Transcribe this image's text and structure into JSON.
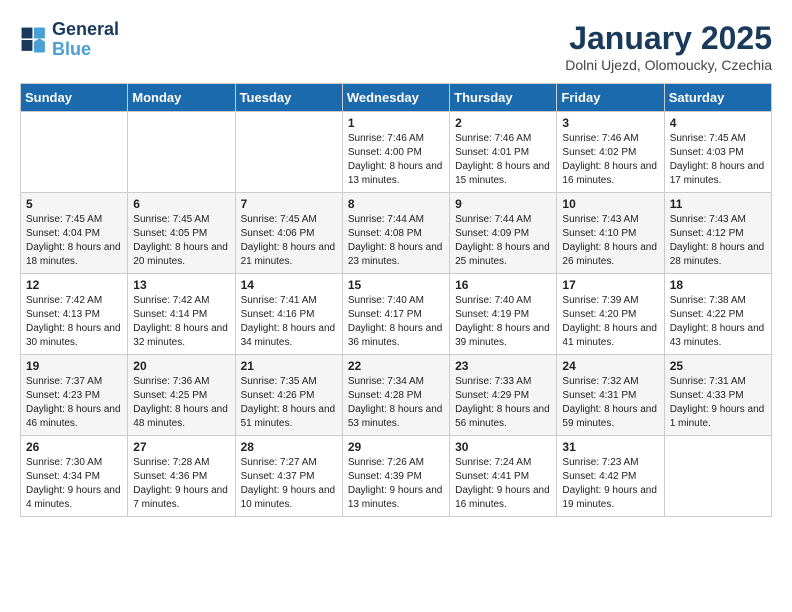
{
  "logo": {
    "line1": "General",
    "line2": "Blue"
  },
  "title": "January 2025",
  "subtitle": "Dolni Ujezd, Olomoucky, Czechia",
  "weekdays": [
    "Sunday",
    "Monday",
    "Tuesday",
    "Wednesday",
    "Thursday",
    "Friday",
    "Saturday"
  ],
  "weeks": [
    [
      {
        "day": "",
        "info": ""
      },
      {
        "day": "",
        "info": ""
      },
      {
        "day": "",
        "info": ""
      },
      {
        "day": "1",
        "info": "Sunrise: 7:46 AM\nSunset: 4:00 PM\nDaylight: 8 hours and 13 minutes."
      },
      {
        "day": "2",
        "info": "Sunrise: 7:46 AM\nSunset: 4:01 PM\nDaylight: 8 hours and 15 minutes."
      },
      {
        "day": "3",
        "info": "Sunrise: 7:46 AM\nSunset: 4:02 PM\nDaylight: 8 hours and 16 minutes."
      },
      {
        "day": "4",
        "info": "Sunrise: 7:45 AM\nSunset: 4:03 PM\nDaylight: 8 hours and 17 minutes."
      }
    ],
    [
      {
        "day": "5",
        "info": "Sunrise: 7:45 AM\nSunset: 4:04 PM\nDaylight: 8 hours and 18 minutes."
      },
      {
        "day": "6",
        "info": "Sunrise: 7:45 AM\nSunset: 4:05 PM\nDaylight: 8 hours and 20 minutes."
      },
      {
        "day": "7",
        "info": "Sunrise: 7:45 AM\nSunset: 4:06 PM\nDaylight: 8 hours and 21 minutes."
      },
      {
        "day": "8",
        "info": "Sunrise: 7:44 AM\nSunset: 4:08 PM\nDaylight: 8 hours and 23 minutes."
      },
      {
        "day": "9",
        "info": "Sunrise: 7:44 AM\nSunset: 4:09 PM\nDaylight: 8 hours and 25 minutes."
      },
      {
        "day": "10",
        "info": "Sunrise: 7:43 AM\nSunset: 4:10 PM\nDaylight: 8 hours and 26 minutes."
      },
      {
        "day": "11",
        "info": "Sunrise: 7:43 AM\nSunset: 4:12 PM\nDaylight: 8 hours and 28 minutes."
      }
    ],
    [
      {
        "day": "12",
        "info": "Sunrise: 7:42 AM\nSunset: 4:13 PM\nDaylight: 8 hours and 30 minutes."
      },
      {
        "day": "13",
        "info": "Sunrise: 7:42 AM\nSunset: 4:14 PM\nDaylight: 8 hours and 32 minutes."
      },
      {
        "day": "14",
        "info": "Sunrise: 7:41 AM\nSunset: 4:16 PM\nDaylight: 8 hours and 34 minutes."
      },
      {
        "day": "15",
        "info": "Sunrise: 7:40 AM\nSunset: 4:17 PM\nDaylight: 8 hours and 36 minutes."
      },
      {
        "day": "16",
        "info": "Sunrise: 7:40 AM\nSunset: 4:19 PM\nDaylight: 8 hours and 39 minutes."
      },
      {
        "day": "17",
        "info": "Sunrise: 7:39 AM\nSunset: 4:20 PM\nDaylight: 8 hours and 41 minutes."
      },
      {
        "day": "18",
        "info": "Sunrise: 7:38 AM\nSunset: 4:22 PM\nDaylight: 8 hours and 43 minutes."
      }
    ],
    [
      {
        "day": "19",
        "info": "Sunrise: 7:37 AM\nSunset: 4:23 PM\nDaylight: 8 hours and 46 minutes."
      },
      {
        "day": "20",
        "info": "Sunrise: 7:36 AM\nSunset: 4:25 PM\nDaylight: 8 hours and 48 minutes."
      },
      {
        "day": "21",
        "info": "Sunrise: 7:35 AM\nSunset: 4:26 PM\nDaylight: 8 hours and 51 minutes."
      },
      {
        "day": "22",
        "info": "Sunrise: 7:34 AM\nSunset: 4:28 PM\nDaylight: 8 hours and 53 minutes."
      },
      {
        "day": "23",
        "info": "Sunrise: 7:33 AM\nSunset: 4:29 PM\nDaylight: 8 hours and 56 minutes."
      },
      {
        "day": "24",
        "info": "Sunrise: 7:32 AM\nSunset: 4:31 PM\nDaylight: 8 hours and 59 minutes."
      },
      {
        "day": "25",
        "info": "Sunrise: 7:31 AM\nSunset: 4:33 PM\nDaylight: 9 hours and 1 minute."
      }
    ],
    [
      {
        "day": "26",
        "info": "Sunrise: 7:30 AM\nSunset: 4:34 PM\nDaylight: 9 hours and 4 minutes."
      },
      {
        "day": "27",
        "info": "Sunrise: 7:28 AM\nSunset: 4:36 PM\nDaylight: 9 hours and 7 minutes."
      },
      {
        "day": "28",
        "info": "Sunrise: 7:27 AM\nSunset: 4:37 PM\nDaylight: 9 hours and 10 minutes."
      },
      {
        "day": "29",
        "info": "Sunrise: 7:26 AM\nSunset: 4:39 PM\nDaylight: 9 hours and 13 minutes."
      },
      {
        "day": "30",
        "info": "Sunrise: 7:24 AM\nSunset: 4:41 PM\nDaylight: 9 hours and 16 minutes."
      },
      {
        "day": "31",
        "info": "Sunrise: 7:23 AM\nSunset: 4:42 PM\nDaylight: 9 hours and 19 minutes."
      },
      {
        "day": "",
        "info": ""
      }
    ]
  ]
}
